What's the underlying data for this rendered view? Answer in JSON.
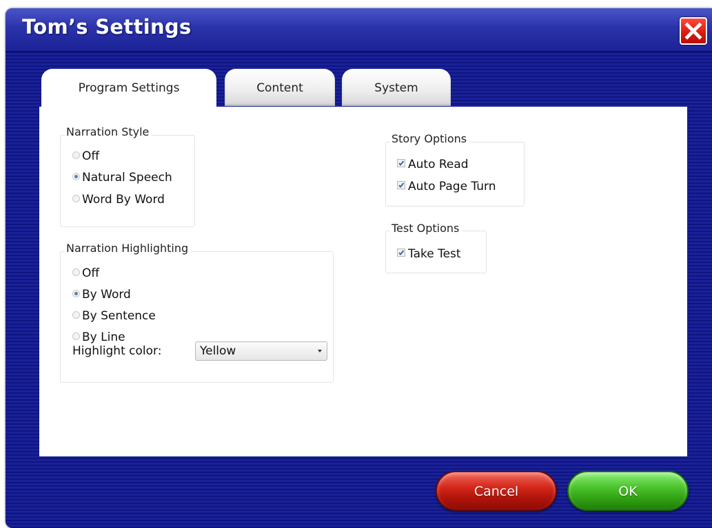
{
  "window": {
    "title": "Tom’s Settings"
  },
  "tabs": [
    {
      "label": "Program Settings",
      "active": true
    },
    {
      "label": "Content",
      "active": false
    },
    {
      "label": "System",
      "active": false
    }
  ],
  "narration_style": {
    "title": "Narration Style",
    "options": [
      {
        "label": "Off",
        "selected": false
      },
      {
        "label": "Natural Speech",
        "selected": true
      },
      {
        "label": "Word By Word",
        "selected": false
      }
    ]
  },
  "narration_highlighting": {
    "title": "Narration Highlighting",
    "options": [
      {
        "label": "Off",
        "selected": false
      },
      {
        "label": "By Word",
        "selected": true
      },
      {
        "label": "By Sentence",
        "selected": false
      },
      {
        "label": "By Line",
        "selected": false
      }
    ],
    "color_label": "Highlight color:",
    "color_value": "Yellow"
  },
  "story_options": {
    "title": "Story Options",
    "options": [
      {
        "label": "Auto Read",
        "checked": true
      },
      {
        "label": "Auto Page Turn",
        "checked": true
      }
    ]
  },
  "test_options": {
    "title": "Test Options",
    "options": [
      {
        "label": "Take Test",
        "checked": true
      }
    ]
  },
  "buttons": {
    "cancel": "Cancel",
    "ok": "OK"
  },
  "icons": {
    "close": "close-icon",
    "dropdown": "chevron-down-icon"
  },
  "colors": {
    "background": "#141a8e",
    "titlebar": "#2b33aa",
    "close_button": "#d81a10",
    "cancel_button": "#c01d10",
    "ok_button": "#3cae1e"
  }
}
